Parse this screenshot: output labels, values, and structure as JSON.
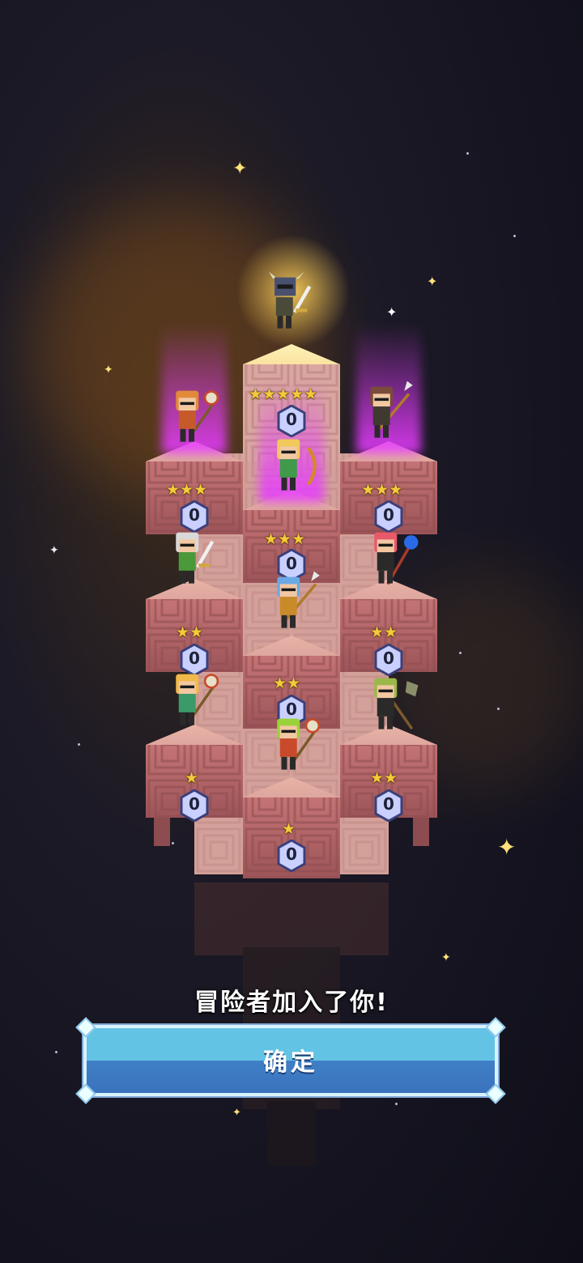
{
  "message": "冒险者加入了你!",
  "confirm_label": "确定",
  "colors": {
    "brick": "#c97a78",
    "brick_dark": "#8d4c4f",
    "brick_light": "#e6b2a6",
    "star": "#f5c93a",
    "badge": "#c9d0ff",
    "button_top": "#63c3e4",
    "button_bottom": "#3a73bd",
    "beam": "#e63cff"
  },
  "heroes": [
    {
      "id": "knight-leader",
      "stars": "★★★★★",
      "level": "0",
      "hair": "#3c4a66",
      "outfit": "#4a4a3a",
      "weapon": "sword",
      "rarity": "legendary"
    },
    {
      "id": "orange-hair-mace",
      "stars": "★★★",
      "level": "0",
      "hair": "#e28a3a",
      "outfit": "#c65a2a",
      "weapon": "mace",
      "rarity": "epic"
    },
    {
      "id": "blonde-archer",
      "stars": "★★★",
      "level": "0",
      "hair": "#f2c95a",
      "outfit": "#3f9a4a",
      "weapon": "bow",
      "rarity": "epic"
    },
    {
      "id": "brown-ponytail-spear",
      "stars": "★★★",
      "level": "0",
      "hair": "#7a4a3a",
      "outfit": "#3f3a2f",
      "weapon": "spear",
      "rarity": "epic"
    },
    {
      "id": "silver-hair-sword",
      "stars": "★★",
      "level": "0",
      "hair": "#d9d9d9",
      "outfit": "#4a9a3a",
      "weapon": "sword"
    },
    {
      "id": "blue-hair-spear",
      "stars": "★★",
      "level": "0",
      "hair": "#6aa9e6",
      "outfit": "#c98a2a",
      "weapon": "spear"
    },
    {
      "id": "red-hair-staff",
      "stars": "★★",
      "level": "0",
      "hair": "#e85a6a",
      "outfit": "#2a2a2a",
      "weapon": "staff"
    },
    {
      "id": "blonde-bun-mace",
      "stars": "★",
      "level": "0",
      "hair": "#f0b94a",
      "outfit": "#3a9a6a",
      "weapon": "mace"
    },
    {
      "id": "green-hair-mace",
      "stars": "★",
      "level": "0",
      "hair": "#9ad23a",
      "outfit": "#c84a2a",
      "weapon": "mace"
    },
    {
      "id": "green-hair-axe",
      "stars": "★★",
      "level": "0",
      "hair": "#9ab84a",
      "outfit": "#2a2a2a",
      "weapon": "axe"
    }
  ]
}
